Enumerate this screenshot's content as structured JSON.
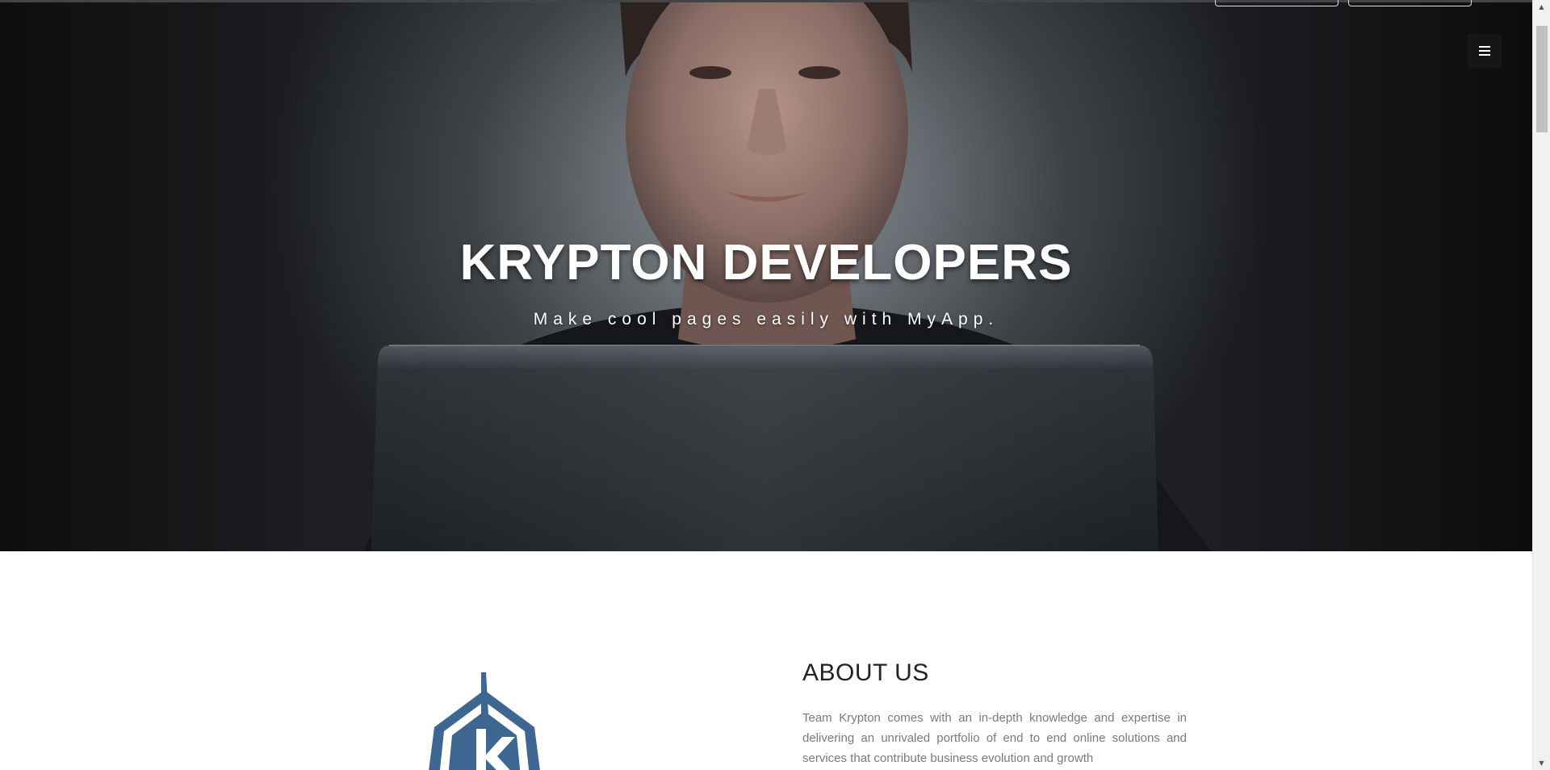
{
  "hero": {
    "title": "KRYPTON DEVELOPERS",
    "subtitle": "Make cool pages easily with MyApp."
  },
  "nav": {
    "menu_icon": "hamburger-icon"
  },
  "about": {
    "heading": "ABOUT US",
    "text": "Team Krypton comes with an in-depth knowledge and expertise in delivering an unrivaled portfolio of end to end online solutions and services that contribute business evolution and growth",
    "logo_icon": "krypton-logo-icon"
  },
  "colors": {
    "logo_blue": "#3d6690",
    "hero_dark": "#1d1f22"
  }
}
